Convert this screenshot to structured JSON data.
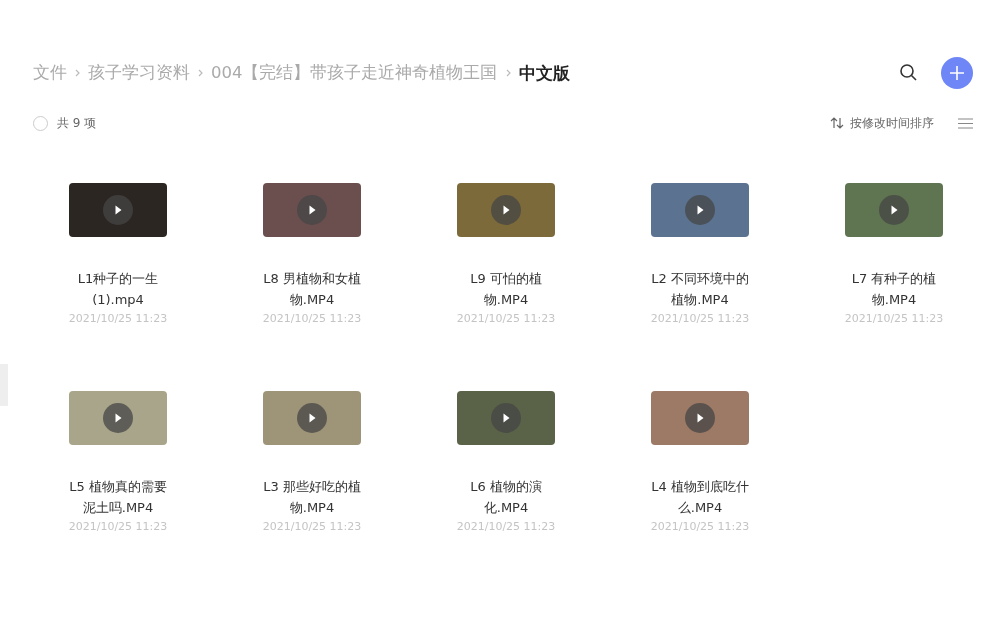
{
  "breadcrumb": [
    {
      "label": "文件",
      "current": false
    },
    {
      "label": "孩子学习资料",
      "current": false
    },
    {
      "label": "004【完结】带孩子走近神奇植物王国",
      "current": false
    },
    {
      "label": "中文版",
      "current": true
    }
  ],
  "toolbar": {
    "all_checked": false,
    "count": "共 9 项",
    "sort": "按修改时间排序"
  },
  "files": [
    {
      "name_lines": [
        "L1种子的一生",
        "(1).mp4"
      ],
      "date": "2021/10/25 11:23"
    },
    {
      "name_lines": [
        "L8 男植物和女植",
        "物.MP4"
      ],
      "date": "2021/10/25 11:23"
    },
    {
      "name_lines": [
        "L9 可怕的植",
        "物.MP4"
      ],
      "date": "2021/10/25 11:23"
    },
    {
      "name_lines": [
        "L2 不同环境中的",
        "植物.MP4"
      ],
      "date": "2021/10/25 11:23"
    },
    {
      "name_lines": [
        "L7 有种子的植",
        "物.MP4"
      ],
      "date": "2021/10/25 11:23"
    },
    {
      "name_lines": [
        "L5 植物真的需要",
        "泥土吗.MP4"
      ],
      "date": "2021/10/25 11:23"
    },
    {
      "name_lines": [
        "L3 那些好吃的植",
        "物.MP4"
      ],
      "date": "2021/10/25 11:23"
    },
    {
      "name_lines": [
        "L6 植物的演",
        "化.MP4"
      ],
      "date": "2021/10/25 11:23"
    },
    {
      "name_lines": [
        "L4 植物到底吃什",
        "么.MP4"
      ],
      "date": "2021/10/25 11:23"
    }
  ]
}
